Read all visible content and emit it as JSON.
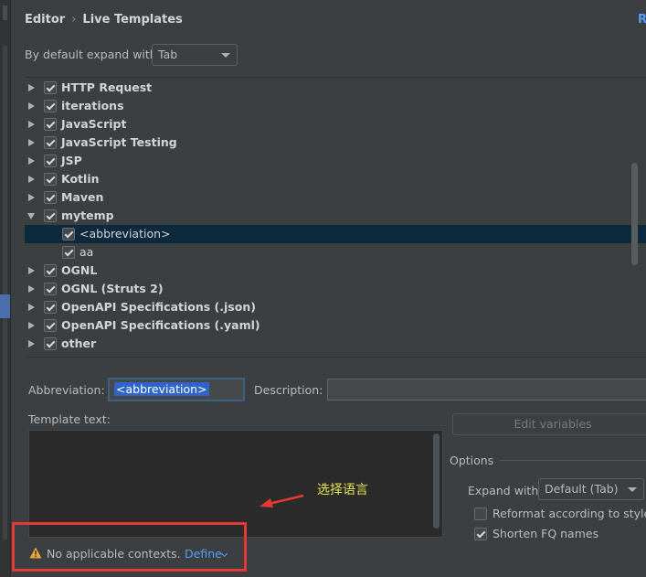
{
  "breadcrumb": {
    "parent": "Editor",
    "separator": "›",
    "current": "Live Templates",
    "right_link": "R"
  },
  "expand_default": {
    "label": "By default expand with",
    "value": "Tab"
  },
  "tree": {
    "rows": [
      {
        "label": "HTTP Request",
        "checked": true,
        "kind": "group",
        "expanded": false
      },
      {
        "label": "iterations",
        "checked": true,
        "kind": "group",
        "expanded": false
      },
      {
        "label": "JavaScript",
        "checked": true,
        "kind": "group",
        "expanded": false
      },
      {
        "label": "JavaScript Testing",
        "checked": true,
        "kind": "group",
        "expanded": false
      },
      {
        "label": "JSP",
        "checked": true,
        "kind": "group",
        "expanded": false
      },
      {
        "label": "Kotlin",
        "checked": true,
        "kind": "group",
        "expanded": false
      },
      {
        "label": "Maven",
        "checked": true,
        "kind": "group",
        "expanded": false
      },
      {
        "label": "mytemp",
        "checked": true,
        "kind": "group",
        "expanded": true
      },
      {
        "label": "<abbreviation>",
        "checked": true,
        "kind": "item",
        "selected": true
      },
      {
        "label": "aa",
        "checked": true,
        "kind": "item"
      },
      {
        "label": "OGNL",
        "checked": true,
        "kind": "group",
        "expanded": false
      },
      {
        "label": "OGNL (Struts 2)",
        "checked": true,
        "kind": "group",
        "expanded": false
      },
      {
        "label": "OpenAPI Specifications (.json)",
        "checked": true,
        "kind": "group",
        "expanded": false
      },
      {
        "label": "OpenAPI Specifications (.yaml)",
        "checked": true,
        "kind": "group",
        "expanded": false
      },
      {
        "label": "other",
        "checked": true,
        "kind": "group",
        "expanded": false
      }
    ]
  },
  "editor": {
    "abbreviation_label": "Abbreviation:",
    "abbreviation_value": "<abbreviation>",
    "description_label": "Description:",
    "description_value": "",
    "template_text_label": "Template text:",
    "template_text_value": "",
    "edit_variables_label": "Edit variables"
  },
  "options": {
    "title": "Options",
    "expand_with_label": "Expand with",
    "expand_with_value": "Default (Tab)",
    "reformat_label": "Reformat according to style",
    "reformat_checked": false,
    "shorten_label": "Shorten FQ names",
    "shorten_checked": true
  },
  "context": {
    "warning_text": "No applicable contexts.",
    "define_label": "Define"
  },
  "annotation": {
    "text": "选择语言",
    "color": "#e6e64c"
  },
  "colors": {
    "accent": "#589df6",
    "selection": "#0d293e",
    "highlight_box": "#e53935",
    "warning": "#f0a732"
  }
}
